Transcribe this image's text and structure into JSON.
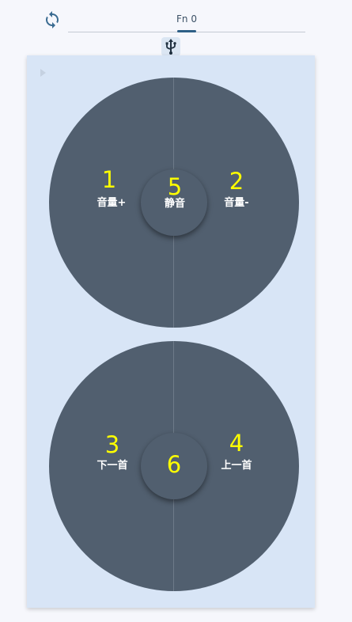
{
  "toolbar": {
    "sync_icon": "sync-icon",
    "tab_label": "Fn 0",
    "usb_icon": "usb-icon",
    "accent_color": "#2e5f86"
  },
  "panel": {
    "background": "#d8e5f6",
    "knob_color": "#515f6f",
    "number_color": "#ffff00"
  },
  "knobs": [
    {
      "left": {
        "number": "1",
        "label": "音量+"
      },
      "center": {
        "number": "5",
        "label": "静音"
      },
      "right": {
        "number": "2",
        "label": "音量-"
      }
    },
    {
      "left": {
        "number": "3",
        "label": "下一首"
      },
      "center": {
        "number": "6",
        "label": ""
      },
      "right": {
        "number": "4",
        "label": "上一首"
      }
    }
  ]
}
